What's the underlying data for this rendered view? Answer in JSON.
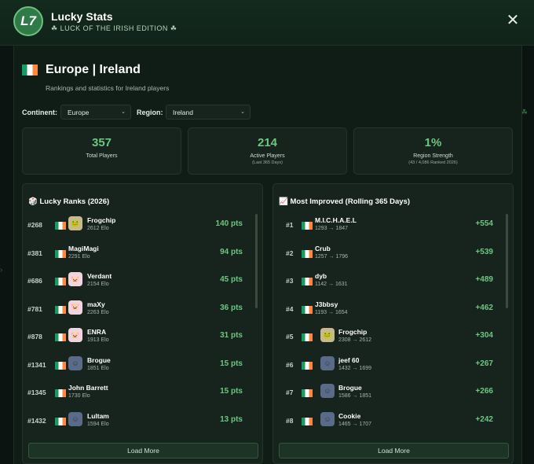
{
  "app": {
    "logo_text": "L7",
    "title": "Lucky Stats",
    "subtitle": "☘ LUCK OF THE IRISH EDITION ☘",
    "close_label": "✕"
  },
  "region": {
    "title": "Europe | Ireland",
    "description": "Rankings and statistics for Ireland players"
  },
  "filters": {
    "continent_label": "Continent:",
    "continent_value": "Europe",
    "region_label": "Region:",
    "region_value": "Ireland"
  },
  "stats": [
    {
      "value": "357",
      "label": "Total Players",
      "sub": ""
    },
    {
      "value": "214",
      "label": "Active Players",
      "sub": "(Last 365 Days)"
    },
    {
      "value": "1%",
      "label": "Region Strength",
      "sub": "(43 / 4,086 Ranked 2026)"
    }
  ],
  "lucky_ranks": {
    "title": "🎲 Lucky Ranks (2026)",
    "load_more": "Load More",
    "rows": [
      {
        "rank": "#268",
        "name": "Frogchip",
        "elo": "2612 Elo",
        "pts": "140 pts",
        "avatar": "frog-avatar-icon"
      },
      {
        "rank": "#381",
        "name": "MagiMagi",
        "elo": "2291 Elo",
        "pts": "94 pts",
        "avatar": ""
      },
      {
        "rank": "#686",
        "name": "Verdant",
        "elo": "2154 Elo",
        "pts": "45 pts",
        "avatar": "pig-avatar-icon"
      },
      {
        "rank": "#781",
        "name": "maXy",
        "elo": "2263 Elo",
        "pts": "36 pts",
        "avatar": "pig-avatar-icon"
      },
      {
        "rank": "#878",
        "name": "ENRA",
        "elo": "1913 Elo",
        "pts": "31 pts",
        "avatar": "pig-avatar-icon"
      },
      {
        "rank": "#1341",
        "name": "Brogue",
        "elo": "1851 Elo",
        "pts": "15 pts",
        "avatar": "skin-avatar-icon"
      },
      {
        "rank": "#1345",
        "name": "John Barrett",
        "elo": "1730 Elo",
        "pts": "15 pts",
        "avatar": ""
      },
      {
        "rank": "#1432",
        "name": "Lultam",
        "elo": "1594 Elo",
        "pts": "13 pts",
        "avatar": "skin-avatar-icon"
      }
    ]
  },
  "most_improved": {
    "title": "📈 Most Improved (Rolling 365 Days)",
    "load_more": "Load More",
    "rows": [
      {
        "rank": "#1",
        "name": "M.I.C.H.A.E.L",
        "elo": "1293 → 1847",
        "pts": "+554",
        "avatar": ""
      },
      {
        "rank": "#2",
        "name": "Crub",
        "elo": "1257 → 1796",
        "pts": "+539",
        "avatar": ""
      },
      {
        "rank": "#3",
        "name": "dyb",
        "elo": "1142 → 1631",
        "pts": "+489",
        "avatar": ""
      },
      {
        "rank": "#4",
        "name": "J3bbsy",
        "elo": "1193 → 1654",
        "pts": "+462",
        "avatar": ""
      },
      {
        "rank": "#5",
        "name": "Frogchip",
        "elo": "2308 → 2612",
        "pts": "+304",
        "avatar": "frog-avatar-icon"
      },
      {
        "rank": "#6",
        "name": "jeef 60",
        "elo": "1432 → 1699",
        "pts": "+267",
        "avatar": "skin-avatar-icon"
      },
      {
        "rank": "#7",
        "name": "Brogue",
        "elo": "1586 → 1851",
        "pts": "+266",
        "avatar": "skin-avatar-icon"
      },
      {
        "rank": "#8",
        "name": "Cookie",
        "elo": "1465 → 1707",
        "pts": "+242",
        "avatar": "skin-avatar-icon"
      }
    ]
  },
  "colors": {
    "accent_green": "#6cc781",
    "background": "#0b1410",
    "card": "#16241d"
  }
}
